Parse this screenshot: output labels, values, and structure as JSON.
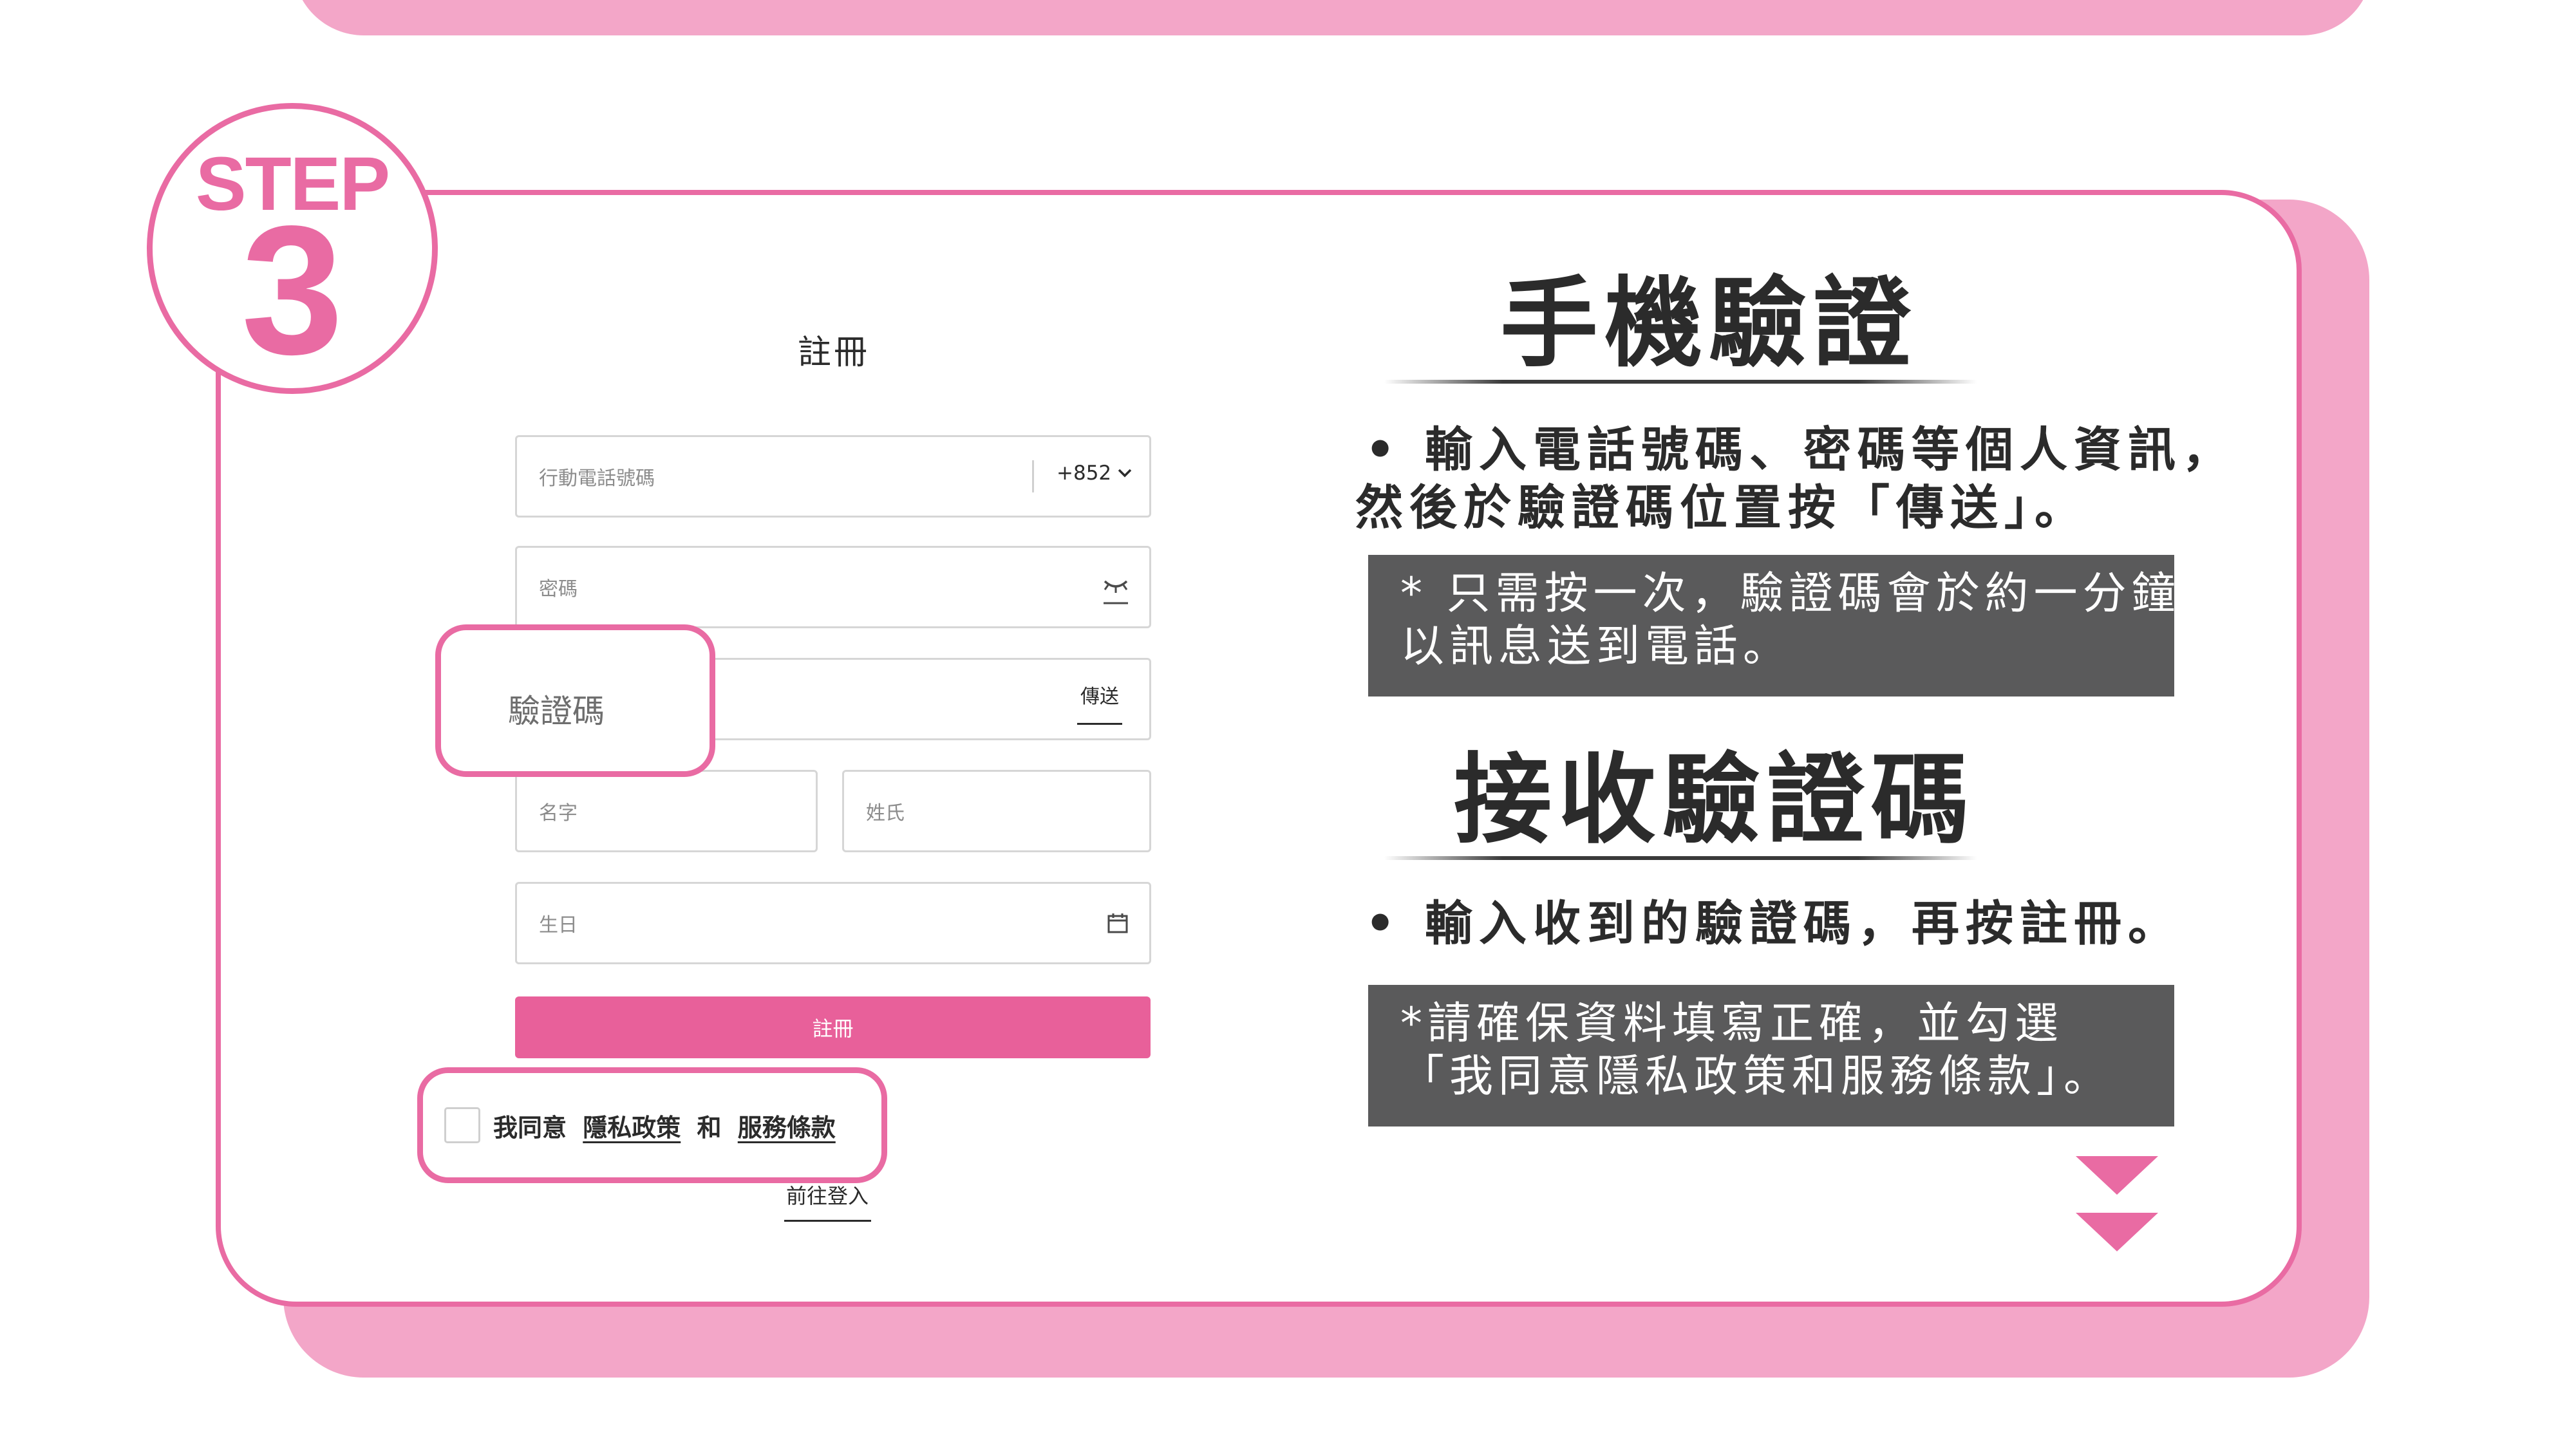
{
  "step": {
    "word": "STEP",
    "number": "3"
  },
  "form": {
    "title": "註冊",
    "phone": {
      "placeholder": "行動電話號碼",
      "country_code": "+852"
    },
    "password": {
      "placeholder": "密碼"
    },
    "verification": {
      "label": "驗證碼",
      "send_label": "傳送"
    },
    "first_name": {
      "placeholder": "名字"
    },
    "last_name": {
      "placeholder": "姓氏"
    },
    "birthday": {
      "placeholder": "生日"
    },
    "submit_label": "註冊",
    "agree": {
      "prefix": "我同意",
      "privacy": "隱私政策",
      "and": "和",
      "terms": "服務條款"
    },
    "login_link": "前往登入"
  },
  "instructions": {
    "section1": {
      "title": "手機驗證",
      "bullet_line1": "• 輸入電話號碼、密碼等個人資訊，",
      "bullet_line2": "然後於驗證碼位置按「傳送」。",
      "note_line1": "* 只需按一次，驗證碼會於約一分鐘",
      "note_line2": "以訊息送到電話。"
    },
    "section2": {
      "title": "接收驗證碼",
      "bullet": "• 輸入收到的驗證碼，再按註冊。",
      "note_line1": "*請確保資料填寫正確，並勾選",
      "note_line2": "「我同意隱私政策和服務條款」。"
    }
  },
  "colors": {
    "accent": "#e96ba3",
    "shadow_pink": "#f3a6c8",
    "button_pink": "#e8609a",
    "note_gray": "#5a5a5b",
    "text_dark": "#2b2b2b"
  },
  "icons": {
    "phone_dropdown": "chevron-down-icon",
    "password_toggle": "eye-closed-icon",
    "birthday": "calendar-icon",
    "next": "double-triangle-down-icon"
  }
}
